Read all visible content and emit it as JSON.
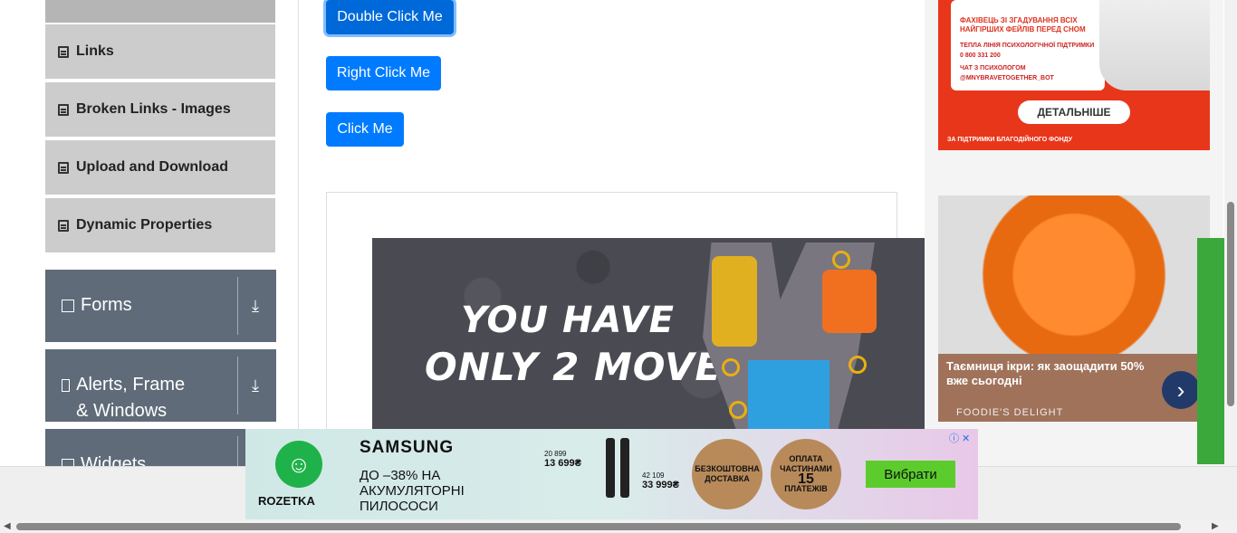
{
  "sidebar": {
    "items": [
      {
        "label": "Links"
      },
      {
        "label": "Broken Links - Images"
      },
      {
        "label": "Upload and Download"
      },
      {
        "label": "Dynamic Properties"
      }
    ],
    "groups": [
      {
        "label": "Forms"
      },
      {
        "label": "Alerts, Frame & Windows"
      },
      {
        "label": "Widgets"
      }
    ]
  },
  "buttons": {
    "double_click": "Double Click Me",
    "right_click": "Right Click Me",
    "click": "Click Me"
  },
  "game_ad": {
    "line1": "YOU HAVE",
    "line2": "ONLY 2 MOVES"
  },
  "red_ad": {
    "headline": "ФАХІВЕЦЬ ЗІ ЗГАДУВАННЯ ВСІХ НАЙГІРШИХ ФЕЙЛІВ ПЕРЕД СНОМ",
    "hotline": "ТЕПЛА ЛІНІЯ ПСИХОЛОГІЧНОЇ ПІДТРИМКИ",
    "phone": "0 800 331 200",
    "chat": "ЧАТ З ПСИХОЛОГОМ",
    "bot": "@MNYBRAVETOGETHER_BOT",
    "button": "ДЕТАЛЬНІШЕ",
    "footer": "ЗА ПІДТРИМКИ БЛАГОДІЙНОГО ФОНДУ"
  },
  "caviar_ad": {
    "title": "Таємниця ікри: як заощадити 50% вже сьогодні",
    "source": "FOODIE'S DELIGHT"
  },
  "rozetka_ad": {
    "store": "ROZETKA",
    "brand": "SAMSUNG",
    "offer": "ДО –38% НА АКУМУЛЯТОРНІ ПИЛОСОСИ",
    "price_old_1": "20 899",
    "price_new_1": "13 699₴",
    "price_old_2": "42 109",
    "price_new_2": "33 999₴",
    "badge1": "БЕЗКОШТОВНА ДОСТАВКА",
    "badge2_top": "ОПЛАТА ЧАСТИНАМИ",
    "badge2_num": "15",
    "badge2_bottom": "ПЛАТЕЖІВ",
    "cta": "Вибрати"
  },
  "colors": {
    "primary_button": "#007bff",
    "sidebar_item_bg": "#cccccc",
    "group_bg": "#5f6b78"
  }
}
